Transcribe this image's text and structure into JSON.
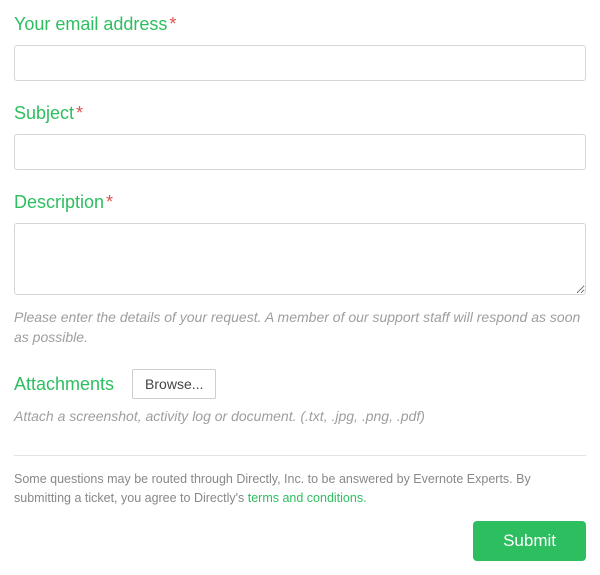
{
  "fields": {
    "email": {
      "label": "Your email address",
      "required": "*"
    },
    "subject": {
      "label": "Subject",
      "required": "*"
    },
    "description": {
      "label": "Description",
      "required": "*",
      "hint": "Please enter the details of your request. A member of our support staff will respond as soon as possible."
    },
    "attachments": {
      "label": "Attachments",
      "browse": "Browse...",
      "hint": "Attach a screenshot, activity log or document. (.txt, .jpg, .png, .pdf)"
    }
  },
  "footer": {
    "text_prefix": "Some questions may be routed through Directly, Inc. to be answered by Evernote Experts. By submitting a ticket, you agree to Directly's ",
    "link_text": "terms and conditions.",
    "submit": "Submit"
  }
}
